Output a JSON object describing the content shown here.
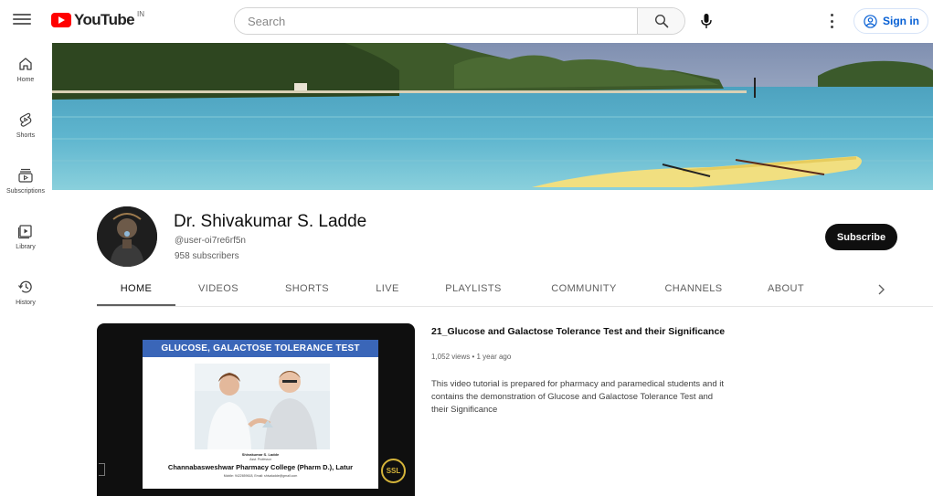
{
  "header": {
    "logo_text": "YouTube",
    "region": "IN",
    "search_placeholder": "Search",
    "sign_in": "Sign in"
  },
  "guide": {
    "items": [
      {
        "label": "Home",
        "icon": "home-icon"
      },
      {
        "label": "Shorts",
        "icon": "shorts-icon"
      },
      {
        "label": "Subscriptions",
        "icon": "subscriptions-icon"
      },
      {
        "label": "Library",
        "icon": "library-icon"
      },
      {
        "label": "History",
        "icon": "history-icon"
      }
    ]
  },
  "channel": {
    "name": "Dr. Shivakumar S. Ladde",
    "handle": "@user-oi7re6rf5n",
    "subscribers": "958 subscribers",
    "subscribe_label": "Subscribe"
  },
  "tabs": [
    {
      "label": "HOME",
      "active": true
    },
    {
      "label": "VIDEOS",
      "active": false
    },
    {
      "label": "SHORTS",
      "active": false
    },
    {
      "label": "LIVE",
      "active": false
    },
    {
      "label": "PLAYLISTS",
      "active": false
    },
    {
      "label": "COMMUNITY",
      "active": false
    },
    {
      "label": "CHANNELS",
      "active": false
    },
    {
      "label": "ABOUT",
      "active": false
    }
  ],
  "featured": {
    "title": "21_Glucose and Galactose Tolerance Test and their Significance",
    "meta": "1,052 views • 1 year ago",
    "description": "This video tutorial is prepared for pharmacy and paramedical students and it contains the demonstration of Glucose and Galactose Tolerance Test and their Significance",
    "slide": {
      "title": "GLUCOSE, GALACTOSE TOLERANCE TEST",
      "author": "Shivakumar S. Ladde",
      "role": "Asst. Professor",
      "college": "Channabasweshwar Pharmacy College (Pharm D.), Latur",
      "contact": "Mobile: 9422659618, Email: shivaladde@gmail.com",
      "badge": "SSL"
    }
  },
  "colors": {
    "brand_red": "#ff0000",
    "link_blue": "#065fd4",
    "slide_header": "#3a66b8"
  }
}
